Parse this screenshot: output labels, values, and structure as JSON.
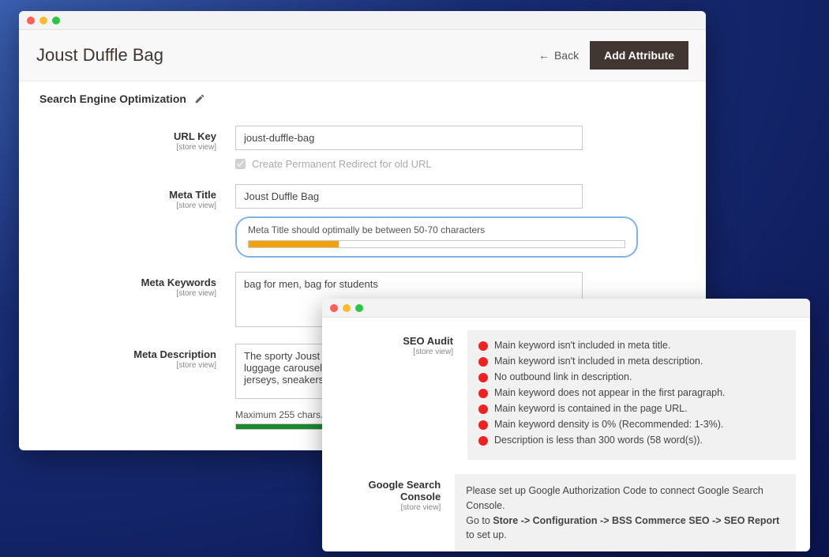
{
  "main": {
    "page_title": "Joust Duffle Bag",
    "back_label": "Back",
    "add_attr_label": "Add Attribute",
    "section_title": "Search Engine Optimization",
    "fields": {
      "url_key": {
        "label": "URL Key",
        "scope": "[store view]",
        "value": "joust-duffle-bag",
        "redirect_label": "Create Permanent Redirect for old URL"
      },
      "meta_title": {
        "label": "Meta Title",
        "scope": "[store view]",
        "value": "Joust Duffle Bag",
        "note": "Meta Title should optimally be between 50-70 characters",
        "bar_pct": 24
      },
      "meta_keywords": {
        "label": "Meta Keywords",
        "scope": "[store view]",
        "value": "bag for men, bag for students"
      },
      "meta_description": {
        "label": "Meta Description",
        "scope": "[store view]",
        "value": "The sporty Joust Duffle Bag can't be beat - on the trail or on your luggage carousel, not anyone else's. The perfect companion for cleats, jerseys, sneakers with plenty of room to spare.",
        "hint": "Maximum 255 chars. Meta Description should optimally be between 150-160 characters"
      }
    }
  },
  "audit": {
    "seo_audit": {
      "label": "SEO Audit",
      "scope": "[store view]"
    },
    "items": [
      "Main keyword isn't included in meta title.",
      "Main keyword isn't included in meta description.",
      "No outbound link in description.",
      "Main keyword does not appear in the first paragraph.",
      "Main keyword is contained in the page URL.",
      "Main keyword density is 0% (Recommended: 1-3%).",
      "Description is less than 300 words (58 word(s))."
    ],
    "console": {
      "label": "Google Search Console",
      "scope": "[store view]",
      "line1": "Please set up Google Authorization Code to connect Google Search Console.",
      "line2_a": "Go to ",
      "line2_b": "Store -> Configuration -> BSS Commerce SEO -> SEO Report",
      "line2_c": " to set up."
    }
  }
}
